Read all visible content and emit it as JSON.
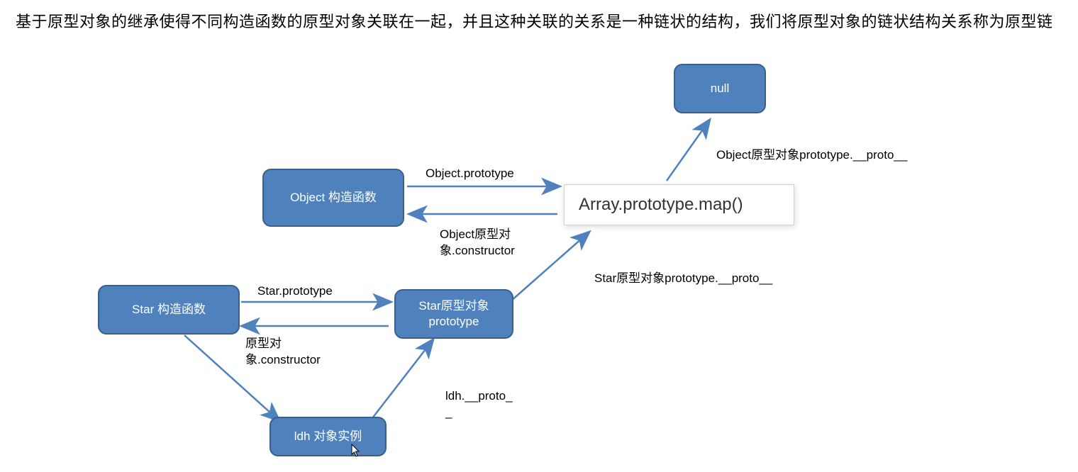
{
  "description": "基于原型对象的继承使得不同构造函数的原型对象关联在一起，并且这种关联的关系是一种链状的结构，我们将原型对象的链状结构关系称为原型链",
  "nodes": {
    "null": {
      "label": "null"
    },
    "objectCtor": {
      "label": "Object 构造函数"
    },
    "starCtor": {
      "label": "Star 构造函数"
    },
    "starProto": {
      "label": "Star原型对象\nprototype"
    },
    "ldh": {
      "label": "ldh 对象实例"
    }
  },
  "tooltip": {
    "text": "Array.prototype.map()"
  },
  "edges": {
    "objProtoLabel": "Object.prototype",
    "objCtorBack": "Object原型对\n象.constructor",
    "starPrototypeLabel": "Star.prototype",
    "starCtorBack": "原型对\n象.constructor",
    "ldhProto": "ldh.__proto_\n_",
    "starProtoProto": "Star原型对象prototype.__proto__",
    "objProtoProto": "Object原型对象prototype.__proto__"
  },
  "colors": {
    "nodeFill": "#4f81bd",
    "nodeBorder": "#3a5f8a",
    "arrow": "#4f81bd"
  }
}
